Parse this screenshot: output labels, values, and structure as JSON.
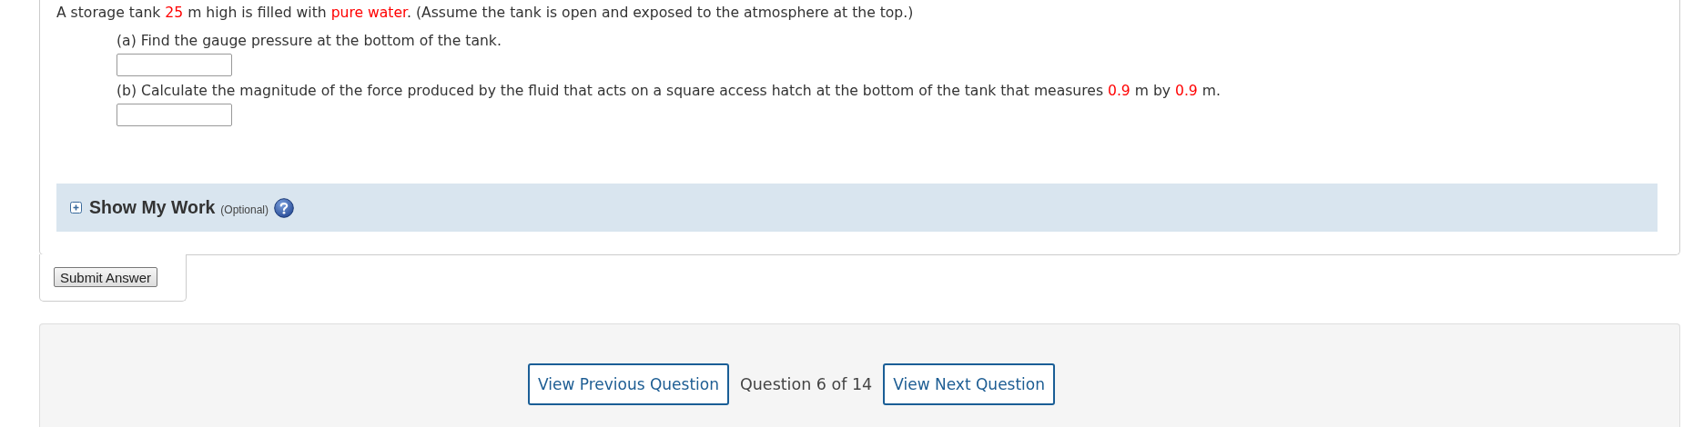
{
  "question": {
    "segments": [
      {
        "text": "A storage tank ",
        "highlight": false
      },
      {
        "text": "25",
        "highlight": true
      },
      {
        "text": " m high is filled with ",
        "highlight": false
      },
      {
        "text": "pure water",
        "highlight": true
      },
      {
        "text": ". (Assume the tank is open and exposed to the atmosphere at the top.)",
        "highlight": false
      }
    ]
  },
  "parts": [
    {
      "segments": [
        {
          "text": "(a) Find the gauge pressure at the bottom of the tank.",
          "highlight": false
        }
      ]
    },
    {
      "segments": [
        {
          "text": "(b) Calculate the magnitude of the force produced by the fluid that acts on a square access hatch at the bottom of the tank that measures ",
          "highlight": false
        },
        {
          "text": "0.9",
          "highlight": true
        },
        {
          "text": " m by ",
          "highlight": false
        },
        {
          "text": "0.9",
          "highlight": true
        },
        {
          "text": " m.",
          "highlight": false
        }
      ]
    }
  ],
  "show_my_work": {
    "title": "Show My Work",
    "note": "(Optional)",
    "expanded": false
  },
  "submit": {
    "label": "Submit Answer"
  },
  "navigation": {
    "previous": "View Previous Question",
    "position": "Question 6 of 14",
    "next": "View Next Question"
  }
}
